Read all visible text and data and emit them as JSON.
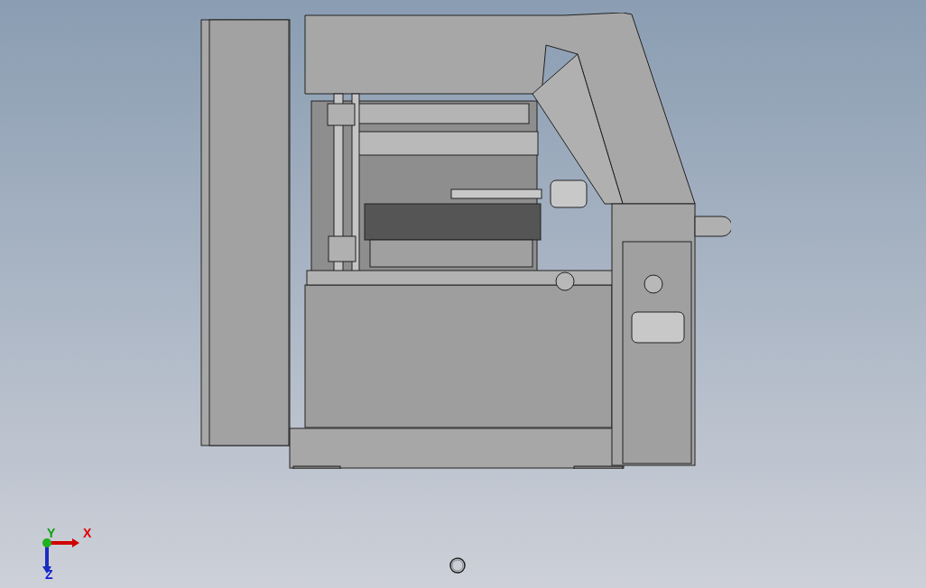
{
  "viewport": {
    "triad": {
      "axes": [
        {
          "label": "X",
          "color": "#e00000"
        },
        {
          "label": "Y",
          "color": "#10a010"
        },
        {
          "label": "Z",
          "color": "#1020d0"
        }
      ]
    }
  }
}
